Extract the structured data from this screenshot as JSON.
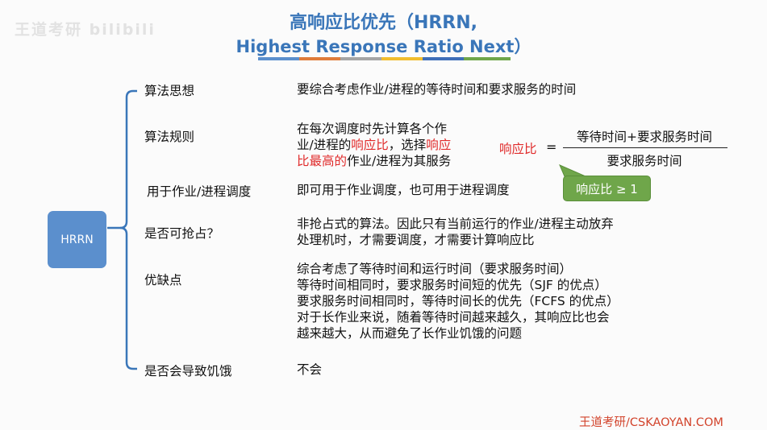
{
  "watermark": "王道考研 bilibili",
  "title": {
    "line1": "高响应比优先（HRRN,",
    "line2": "Highest Response Ratio Next）",
    "bar_colors": [
      "#5b8fcd",
      "#e07c3a",
      "#a5a5a5",
      "#f1bd2e",
      "#3f6fb8",
      "#6fa64a"
    ]
  },
  "root": {
    "label": "HRRN"
  },
  "rows": {
    "idea": {
      "label": "算法思想",
      "text": "要综合考虑作业/进程的等待时间和要求服务的时间"
    },
    "rule": {
      "label": "算法规则",
      "line1": "在每次调度时先计算各个作",
      "line2_a": "业/进程的",
      "line2_b": "响应比",
      "line2_c": "，选择",
      "line2_d": "响应",
      "line3_a": "比最高的",
      "line3_b": "作业/进程为其服务"
    },
    "usage": {
      "label": "用于作业/进程调度",
      "text": "即可用于作业调度，也可用于进程调度"
    },
    "preempt": {
      "label": "是否可抢占？",
      "lines": [
        "非抢占式的算法。因此只有当前运行的作业/进程主动放弃",
        "处理机时，才需要调度，才需要计算响应比"
      ]
    },
    "proscons": {
      "label": "优缺点",
      "lines": [
        "综合考虑了等待时间和运行时间（要求服务时间）",
        "等待时间相同时，要求服务时间短的优先（SJF 的优点）",
        "要求服务时间相同时，等待时间长的优先（FCFS 的优点）",
        "对于长作业来说，随着等待时间越来越久，其响应比也会",
        "越来越大，从而避免了长作业饥饿的问题"
      ]
    },
    "starve": {
      "label": "是否会导致饥饿",
      "text": "不会"
    }
  },
  "formula": {
    "label": "响应比",
    "equals": "=",
    "numerator": "等待时间+要求服务时间",
    "denominator": "要求服务时间",
    "note": "响应比 ≥ 1"
  },
  "footer": "王道考研/CSKAOYAN.COM"
}
